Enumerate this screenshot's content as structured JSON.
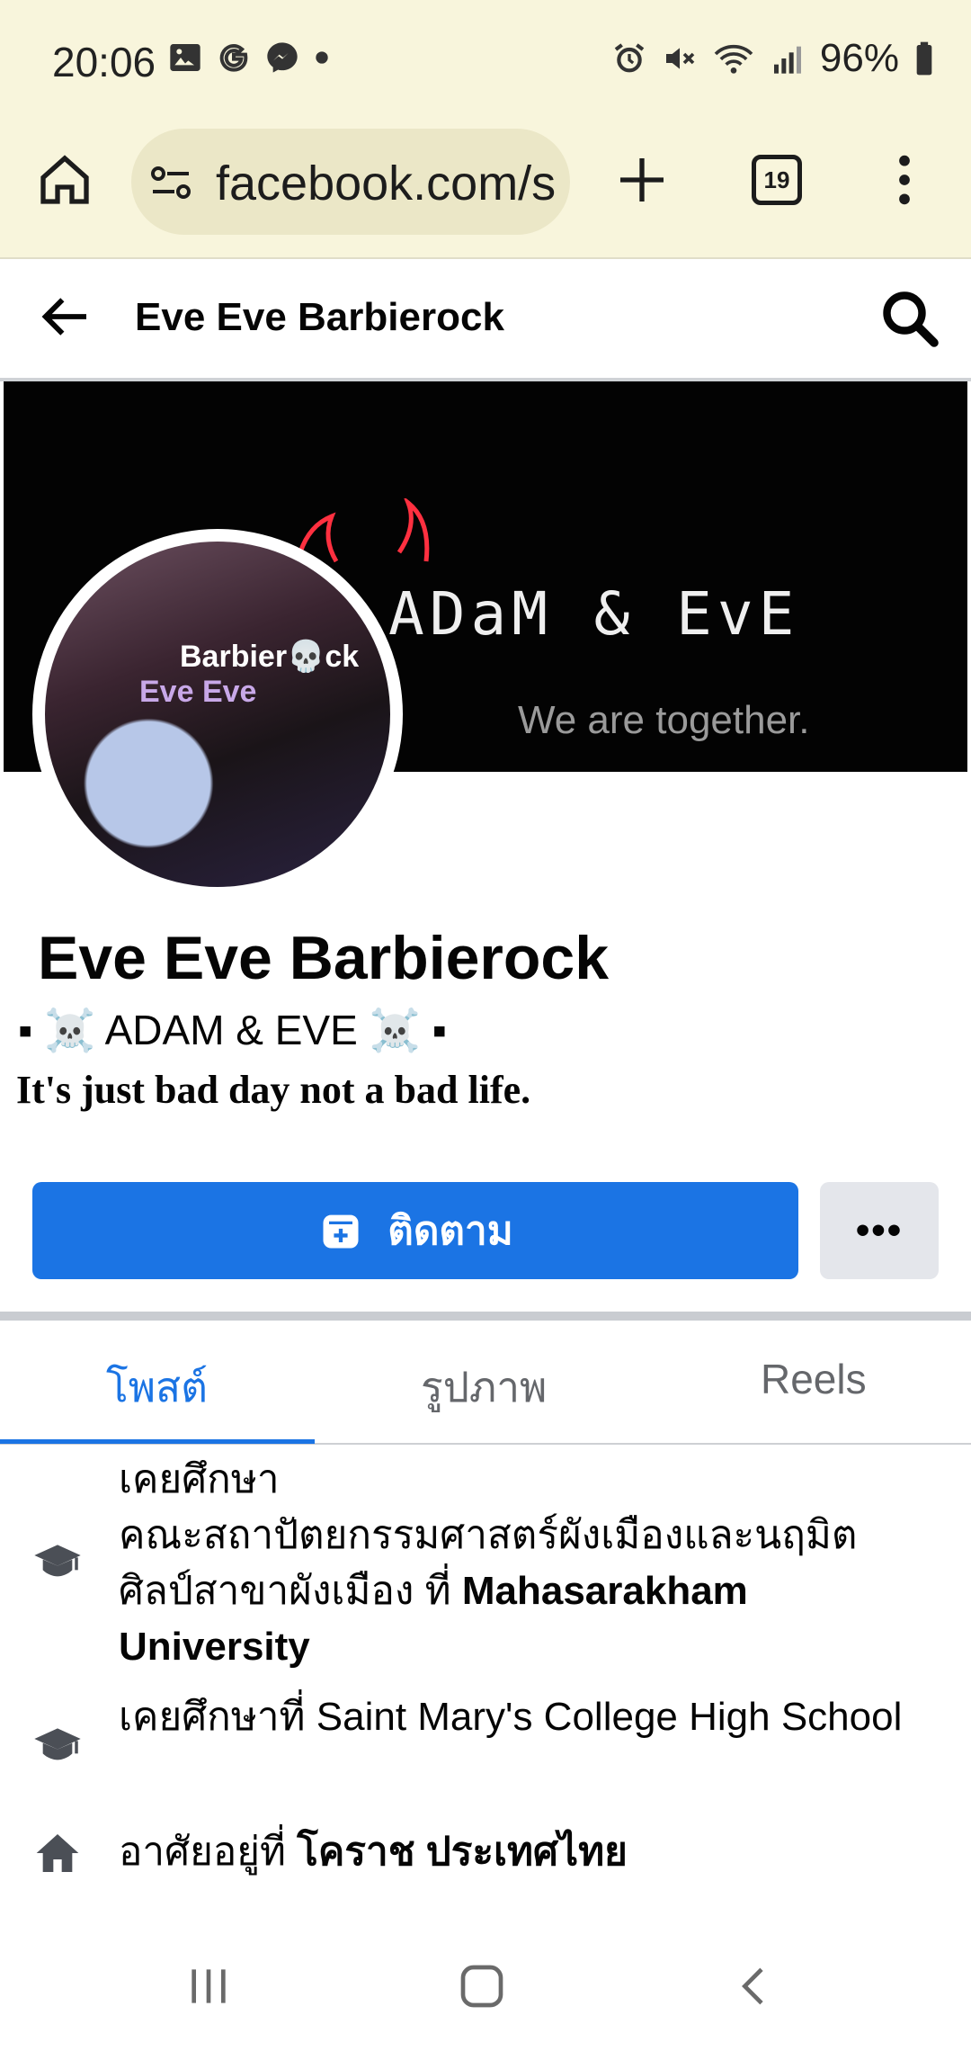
{
  "status_bar": {
    "time": "20:06",
    "battery": "96%",
    "left_icons": [
      "gallery-icon",
      "google-icon",
      "messenger-icon",
      "dot-icon"
    ],
    "right_icons": [
      "alarm-icon",
      "mute-icon",
      "wifi-icon",
      "signal-icon",
      "battery-icon"
    ]
  },
  "browser": {
    "url": "facebook.com/s",
    "tab_count": "19"
  },
  "header": {
    "title": "Eve Eve Barbierock"
  },
  "cover": {
    "title": "ADaM & EvE",
    "subtitle": "We are together."
  },
  "avatar": {
    "overlay_line1": "Barbier💀ck",
    "overlay_line2": "Eve Eve"
  },
  "profile": {
    "name": "Eve Eve Barbierock",
    "bio_line1": "▪ ☠️ ADAM & EVE ☠️ ▪",
    "bio_line2": "It's just bad day not a bad life."
  },
  "actions": {
    "follow_label": "ติดตาม",
    "more_label": "•••"
  },
  "tabs": [
    {
      "label": "โพสต์",
      "active": true
    },
    {
      "label": "รูปภาพ",
      "active": false
    },
    {
      "label": "Reels",
      "active": false
    }
  ],
  "info": {
    "edu1_prefix": "เคยศึกษา",
    "edu1_field": "คณะสถาปัตยกรรมศาสตร์ผังเมืองและนฤมิตศิลป์สาขาผังเมือง ที่ ",
    "edu1_school": "Mahasarakham University",
    "edu2_text": "เคยศึกษาที่ Saint Mary's College High School",
    "home_prefix": "อาศัยอยู่ที่ ",
    "home_place": "โคราช ประเทศไทย"
  },
  "colors": {
    "accent": "#1b74e4",
    "status_bg": "#f8f5dc",
    "url_pill": "#ebe7c7"
  }
}
